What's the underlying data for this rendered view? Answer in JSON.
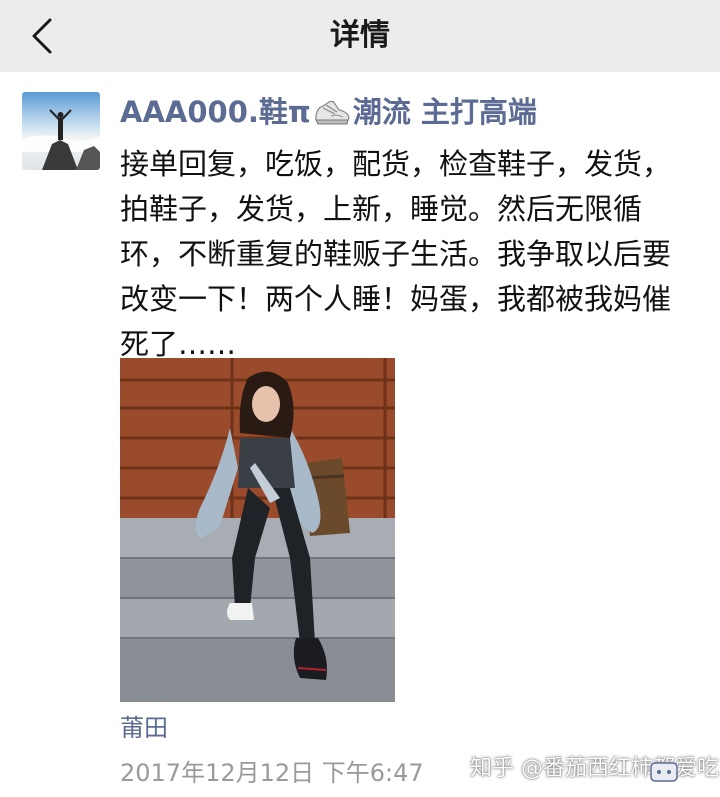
{
  "nav": {
    "title": "详情",
    "back_icon": "chevron-left-icon"
  },
  "post": {
    "author_part1": "AAA000.鞋π",
    "author_icon": "sneaker-icon",
    "author_part2": "潮流  主打高端",
    "text": "接单回复，吃饭，配货，检查鞋子，发货，拍鞋子，发货，上新，睡觉。然后无限循环，不断重复的鞋贩子生活。我争取以后要改变一下！两个人睡！妈蛋，我都被我妈催死了……",
    "location": "莆田",
    "timestamp": "2017年12月12日 下午6:47"
  },
  "watermark": {
    "text": "知乎 @番茄西红柿都爱吃"
  },
  "colors": {
    "nav_bg": "#ececec",
    "link": "#5c6b93",
    "text": "#111111",
    "meta": "#9a9a9a"
  }
}
